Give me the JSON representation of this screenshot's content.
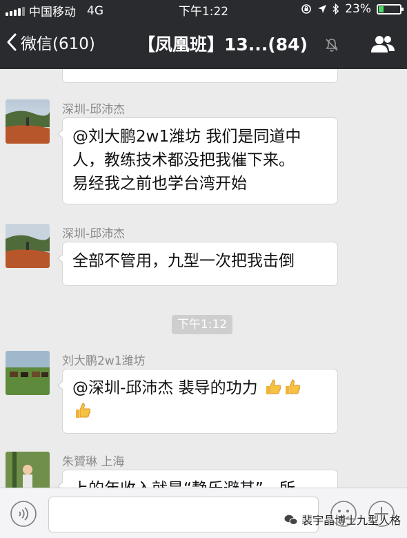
{
  "status_bar": {
    "carrier": "中国移动",
    "network": "4G",
    "time": "下午1:22",
    "battery_percent": "23%",
    "battery_level": 0.23
  },
  "nav": {
    "back_label": "微信(610)",
    "title": "【凤凰班】13...(84)",
    "icons": [
      "chevron-left-icon",
      "mute-bell-icon",
      "contacts-icon"
    ]
  },
  "chat": {
    "messages": [
      {
        "sender": "",
        "lines": []
      },
      {
        "sender": "深圳-邱沛杰",
        "lines": [
          "@刘大鹏2w1潍坊 我们是同道中",
          "人，教练技术都没把我催下来。",
          "易经我之前也学台湾开始"
        ]
      },
      {
        "sender": "深圳-邱沛杰",
        "lines": [
          "全部不管用，九型一次把我击倒"
        ]
      },
      {
        "sender": "刘大鹏2w1潍坊",
        "lines": [
          "@深圳-邱沛杰 裴导的功力"
        ],
        "emoji": [
          "thumbs-up",
          "thumbs-up",
          "thumbs-up"
        ]
      },
      {
        "sender": "朱贇琳 上海",
        "lines": [
          "上的年收入就是“静乐避其”，所"
        ]
      }
    ],
    "timestamp": "下午1:12"
  },
  "input_bar": {
    "value": "",
    "icons": [
      "voice-icon",
      "emoji-icon",
      "plus-icon"
    ]
  },
  "watermark": "裴宇晶博士九型人格",
  "colors": {
    "header_bg": "#2a2b2f",
    "chat_bg": "#ebebeb",
    "bubble_bg": "#ffffff",
    "battery_green": "#4cd964"
  }
}
